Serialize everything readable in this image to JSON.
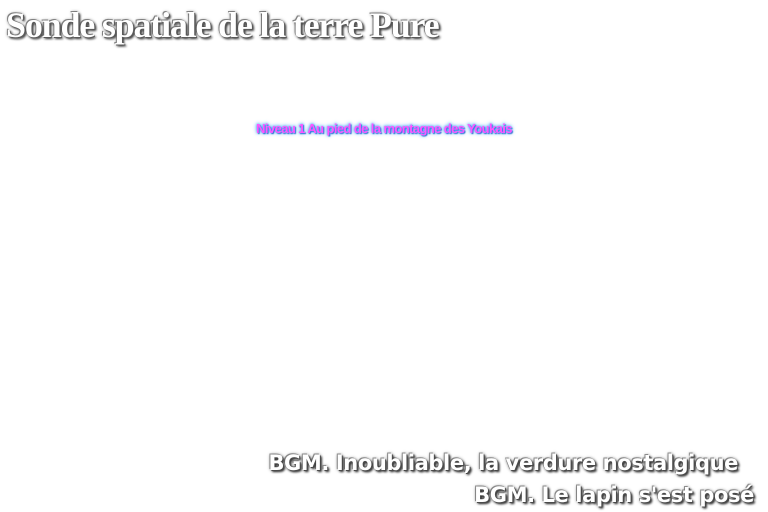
{
  "game": {
    "stage_title": "Sonde spatiale de la terre Pure",
    "level_label": "Niveau 1  Au pied de la montagne des Youkais",
    "bgm": [
      "BGM. Inoubliable, la verdure nostalgique",
      "BGM. Le lapin s'est posé"
    ]
  },
  "colors": {
    "background": "#ffffff",
    "title_text": "#ffffff",
    "level_text": "#ff55ff",
    "level_glow": "#3fa8ff",
    "bgm_text": "#ffffff"
  }
}
